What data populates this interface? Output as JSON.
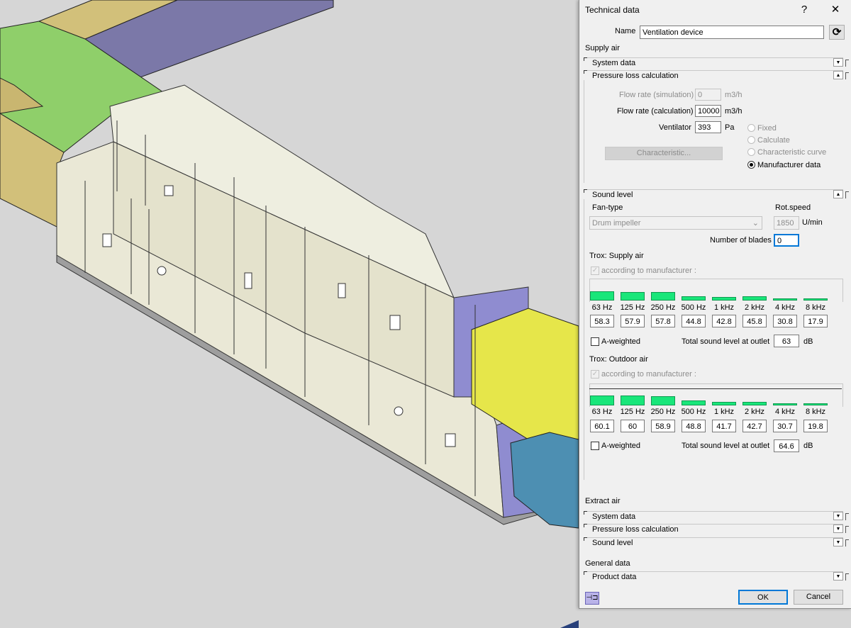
{
  "dialog": {
    "title": "Technical data",
    "help": "?",
    "close": "✕",
    "name_label": "Name",
    "name_value": "Ventilation device",
    "refresh_icon": "refresh-icon"
  },
  "supply_air": {
    "heading": "Supply air",
    "system_data": "System data",
    "pressure_loss": {
      "heading": "Pressure loss calculation",
      "flow_sim_label": "Flow rate (simulation)",
      "flow_sim_value": "0",
      "flow_sim_unit": "m3/h",
      "flow_calc_label": "Flow rate (calculation)",
      "flow_calc_value": "10000",
      "flow_calc_unit": "m3/h",
      "ventilator_label": "Ventilator",
      "ventilator_value": "393",
      "ventilator_unit": "Pa",
      "characteristic_button": "Characteristic...",
      "options": [
        "Fixed",
        "Calculate",
        "Characteristic curve",
        "Manufacturer data"
      ],
      "selected_option": "Manufacturer data"
    },
    "sound_level": {
      "heading": "Sound level",
      "fan_type_label": "Fan-type",
      "fan_type_value": "Drum impeller",
      "rot_speed_label": "Rot.speed",
      "rot_speed_value": "1850",
      "rot_speed_unit": "U/min",
      "blades_label": "Number of blades",
      "blades_value": "0",
      "frequencies": [
        "63 Hz",
        "125 Hz",
        "250 Hz",
        "500 Hz",
        "1 kHz",
        "2 kHz",
        "4 kHz",
        "8 kHz"
      ],
      "supply": {
        "heading": "Trox: Supply air",
        "according": "according to manufacturer :",
        "values": [
          "58.3",
          "57.9",
          "57.8",
          "44.8",
          "42.8",
          "45.8",
          "30.8",
          "17.9"
        ],
        "a_weighted": "A-weighted",
        "total_label": "Total sound level at outlet",
        "total_value": "63",
        "total_unit": "dB"
      },
      "outdoor": {
        "heading": "Trox: Outdoor air",
        "according": "according to manufacturer :",
        "values": [
          "60.1",
          "60",
          "58.9",
          "48.8",
          "41.7",
          "42.7",
          "30.7",
          "19.8"
        ],
        "a_weighted": "A-weighted",
        "total_label": "Total sound level at outlet",
        "total_value": "64.6",
        "total_unit": "dB"
      }
    }
  },
  "extract_air": {
    "heading": "Extract air",
    "system_data": "System data",
    "pressure_loss": "Pressure loss calculation",
    "sound_level": "Sound level"
  },
  "general_data": {
    "heading": "General data",
    "product_data": "Product data"
  },
  "footer": {
    "pin_icon": "pin-icon",
    "ok": "OK",
    "cancel": "Cancel"
  },
  "colors": {
    "green_duct": "#8fcf6a",
    "tan_duct": "#d2c07a",
    "purple_duct": "#7b78a8",
    "yellow_duct": "#e6e64a",
    "blue_duct": "#4d8fb2",
    "unit_body": "#eae8d6",
    "bar_green": "#19e67a"
  }
}
